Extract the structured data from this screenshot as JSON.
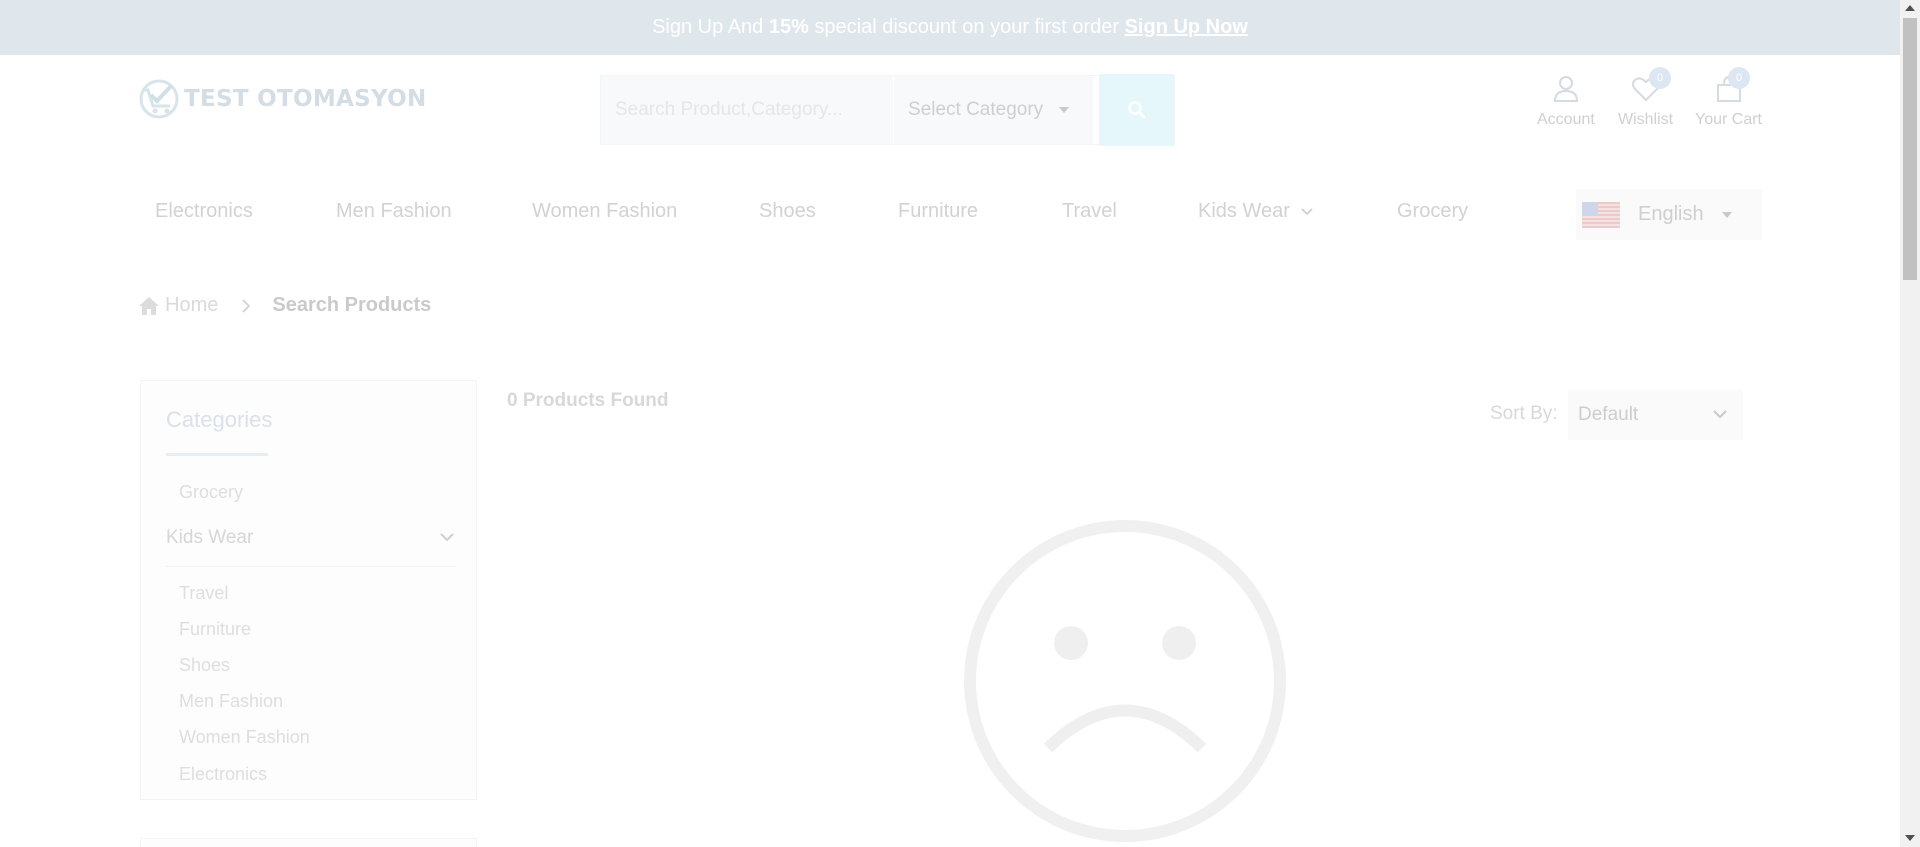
{
  "banner": {
    "text_prefix": "Sign Up And ",
    "discount": "15%",
    "text_middle": " special discount on your first order ",
    "link": "Sign Up Now"
  },
  "header": {
    "logo_text": "TEST OTOMASYON",
    "search_placeholder": "Search Product,Category...",
    "category_select": "Select Category",
    "account_label": "Account",
    "wishlist_label": "Wishlist",
    "wishlist_count": "0",
    "cart_label": "Your Cart",
    "cart_count": "0"
  },
  "nav": {
    "items": [
      "Electronics",
      "Men Fashion",
      "Women Fashion",
      "Shoes",
      "Furniture",
      "Travel",
      "Kids Wear",
      "Grocery"
    ],
    "language": "English"
  },
  "breadcrumb": {
    "home": "Home",
    "current": "Search Products"
  },
  "sidebar": {
    "title": "Categories",
    "top_item": "Grocery",
    "group": "Kids Wear",
    "sub_items": [
      "Travel",
      "Furniture",
      "Shoes",
      "Men Fashion",
      "Women Fashion",
      "Electronics"
    ]
  },
  "results": {
    "count_text": "0 Products Found",
    "sort_label": "Sort By:",
    "sort_value": "Default"
  },
  "colors": {
    "banner_bg": "#dfe6ec",
    "search_button_bg": "#e6f7fb",
    "badge_bg": "#dde6f3"
  }
}
